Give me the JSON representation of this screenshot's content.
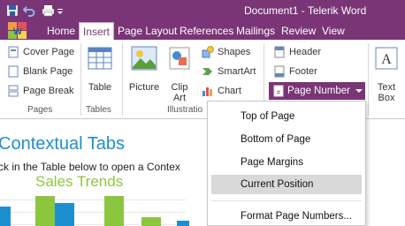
{
  "window": {
    "title": "Document1 - Telerik Word"
  },
  "tabs": [
    "Home",
    "Insert",
    "Page Layout",
    "References",
    "Mailings",
    "Review",
    "View"
  ],
  "active_tab": "Insert",
  "ribbon": {
    "pages": {
      "label": "Pages",
      "items": [
        "Cover Page",
        "Blank Page",
        "Page Break"
      ]
    },
    "tables": {
      "label": "Tables",
      "table": "Table"
    },
    "illustrations": {
      "label": "Illustratio",
      "picture": "Picture",
      "clip_art": [
        "Clip",
        "Art"
      ],
      "shapes": "Shapes",
      "smartart": "SmartArt",
      "chart": "Chart"
    },
    "header_footer": {
      "header": "Header",
      "footer": "Footer",
      "page_number": "Page Number"
    },
    "text_box": [
      "Text",
      "Box"
    ]
  },
  "page_number_menu": {
    "items": [
      "Top of Page",
      "Bottom of Page",
      "Page Margins",
      "Current Position",
      "Format Page Numbers..."
    ],
    "highlighted": "Current Position"
  },
  "document": {
    "heading": "Contextual Tabs",
    "line": "ck in the Table below to open a Contex",
    "chart_title": "Sales Trends"
  },
  "colors": {
    "accent": "#7a3576",
    "heading": "#1d8fd1",
    "chart_green": "#8cc63f",
    "chart_blue": "#1d8fd1",
    "highlight": "#d9d9d9"
  }
}
